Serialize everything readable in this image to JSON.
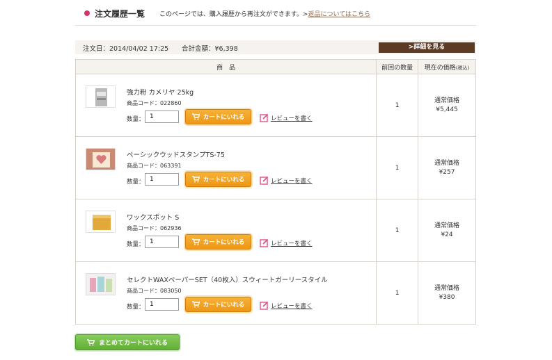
{
  "header": {
    "title": "注文履歴一覧",
    "description": "このページでは、購入履歴から再注文ができます。",
    "link_prefix": ">",
    "link_label": "返品についてはこちら"
  },
  "order": {
    "date_label": "注文日：",
    "date": "2014/04/02 17:25",
    "total_label": "合計金額：",
    "total": "¥6,398",
    "detail_button": ">詳細を見る"
  },
  "table": {
    "headers": {
      "product": "商　品",
      "previous_qty": "前回の数量",
      "current_price": "現在の価格",
      "tax_note": "(税込)"
    }
  },
  "common": {
    "code_label": "商品コード：",
    "qty_label": "数量：",
    "cart_button": "カートにいれる",
    "review_link": "レビューを書く",
    "price_label": "通常価格"
  },
  "items": [
    {
      "name": "強力粉 カメリヤ 25kg",
      "code": "022860",
      "qty": "1",
      "prev_qty": "1",
      "price": "¥5,445"
    },
    {
      "name": "ベーシックウッドスタンプTS-75",
      "code": "063391",
      "qty": "1",
      "prev_qty": "1",
      "price": "¥257"
    },
    {
      "name": "ワックスポット S",
      "code": "062936",
      "qty": "1",
      "prev_qty": "1",
      "price": "¥24"
    },
    {
      "name": "セレクトWAXペーパーSET（40枚入）スウィートガーリースタイル",
      "code": "083050",
      "qty": "1",
      "prev_qty": "1",
      "price": "¥380"
    }
  ],
  "bulk_button": "まとめてカートにいれる",
  "colors": {
    "accent_pink": "#d6336c",
    "brown": "#5c3a24",
    "orange": "#ee9716",
    "green": "#5fae35"
  },
  "icons": {
    "cart": "cart-icon",
    "review": "pencil-square-icon"
  }
}
